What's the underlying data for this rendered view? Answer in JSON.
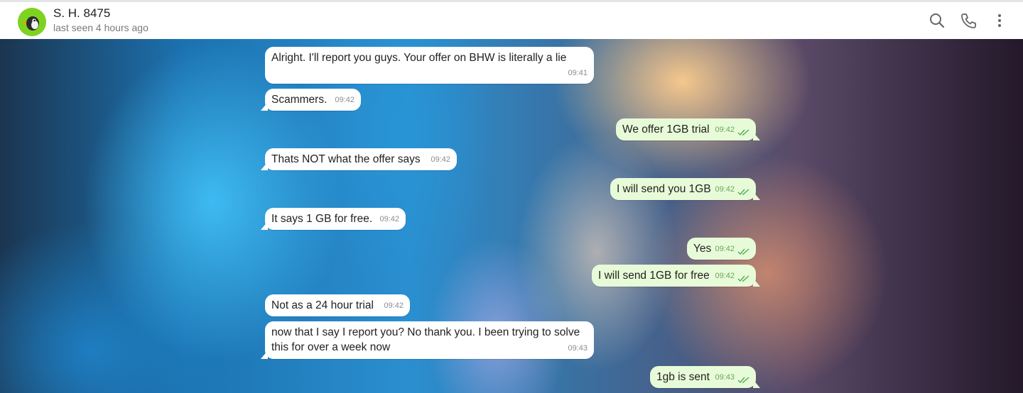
{
  "header": {
    "contact_name": "S. H. 8475",
    "status": "last seen 4 hours ago",
    "icons": [
      "search-icon",
      "phone-icon",
      "more-vertical-icon"
    ]
  },
  "colors": {
    "incoming_bubble": "#ffffff",
    "outgoing_bubble": "#e8fbd8",
    "read_ticks": "#4caf50",
    "avatar_bg": "#7ed321"
  },
  "messages": [
    {
      "direction": "in",
      "text": "Alright. I'll report you guys. Your offer on BHW is literally a lie",
      "time": "09:41"
    },
    {
      "direction": "in",
      "text": "Scammers.",
      "time": "09:42"
    },
    {
      "direction": "out",
      "text": "We offer 1GB trial",
      "time": "09:42",
      "status": "read"
    },
    {
      "direction": "in",
      "text": "Thats NOT what the offer says",
      "time": "09:42"
    },
    {
      "direction": "out",
      "text": "I will send you 1GB",
      "time": "09:42",
      "status": "read"
    },
    {
      "direction": "in",
      "text": "It says 1 GB for free.",
      "time": "09:42"
    },
    {
      "direction": "out",
      "text": "Yes",
      "time": "09:42",
      "status": "read"
    },
    {
      "direction": "out",
      "text": "I will send 1GB for free",
      "time": "09:42",
      "status": "read"
    },
    {
      "direction": "in",
      "text": "Not as a 24 hour trial",
      "time": "09:42"
    },
    {
      "direction": "in",
      "text": "now that I say I report you? No thank you. I been trying to solve\nthis for over a week now",
      "time": "09:43"
    },
    {
      "direction": "out",
      "text": "1gb is sent",
      "time": "09:43",
      "status": "read"
    }
  ]
}
